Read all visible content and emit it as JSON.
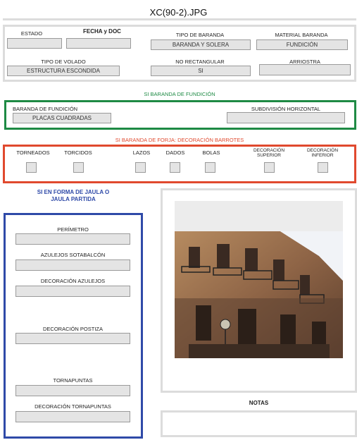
{
  "title": "XC(90-2).JPG",
  "general": {
    "estado": {
      "label": "ESTADO",
      "value": ""
    },
    "fecha_doc": {
      "label": "FECHA y DOC",
      "value": ""
    },
    "tipo_baranda": {
      "label": "TIPO DE BARANDA",
      "value": "BARANDA Y SOLERA"
    },
    "material_baranda": {
      "label": "MATERIAL BARANDA",
      "value": "FUNDICIÓN"
    },
    "tipo_volado": {
      "label": "TIPO DE VOLADO",
      "value": "ESTRUCTURA ESCONDIDA"
    },
    "no_rectangular": {
      "label": "NO RECTANGULAR",
      "value": "SI"
    },
    "arriostra": {
      "label": "ARRIOSTRA",
      "value": ""
    }
  },
  "fundicion": {
    "header": "SI BARANDA DE FUNDICIÓN",
    "baranda_fundicion": {
      "label": "BARANDA DE FUNDICIÓN",
      "value": "PLACAS CUADRADAS"
    },
    "subdivision_horizontal": {
      "label": "SUBDIVISIÓN HORIZONTAL",
      "value": ""
    }
  },
  "forja": {
    "header": "SI BARANDA DE FORJA: DECORACIÓN BARROTES",
    "options": [
      {
        "label": "TORNEADOS"
      },
      {
        "label": "TORCIDOS"
      },
      {
        "label": "LAZOS"
      },
      {
        "label": "DADOS"
      },
      {
        "label": "BOLAS"
      },
      {
        "label_line1": "DECORACIÓN",
        "label_line2": "SUPERIOR"
      },
      {
        "label_line1": "DECORACIÓN",
        "label_line2": "INFERIOR"
      }
    ]
  },
  "jaula": {
    "header_line1": "SI EN FORMA DE JAULA O",
    "header_line2": "JAULA PARTIDA",
    "fields": [
      {
        "label": "PERÍMETRO",
        "value": ""
      },
      {
        "label": "AZULEJOS SOTABALCÓN",
        "value": ""
      },
      {
        "label": "DECORACIÓN AZULEJOS",
        "value": ""
      },
      {
        "label": "DECORACIÓN POSTIZA",
        "value": ""
      },
      {
        "label": "TORNAPUNTAS",
        "value": ""
      },
      {
        "label": "DECORACIÓN TORNAPUNTAS",
        "value": ""
      }
    ]
  },
  "notas": {
    "label": "NOTAS",
    "value": ""
  }
}
